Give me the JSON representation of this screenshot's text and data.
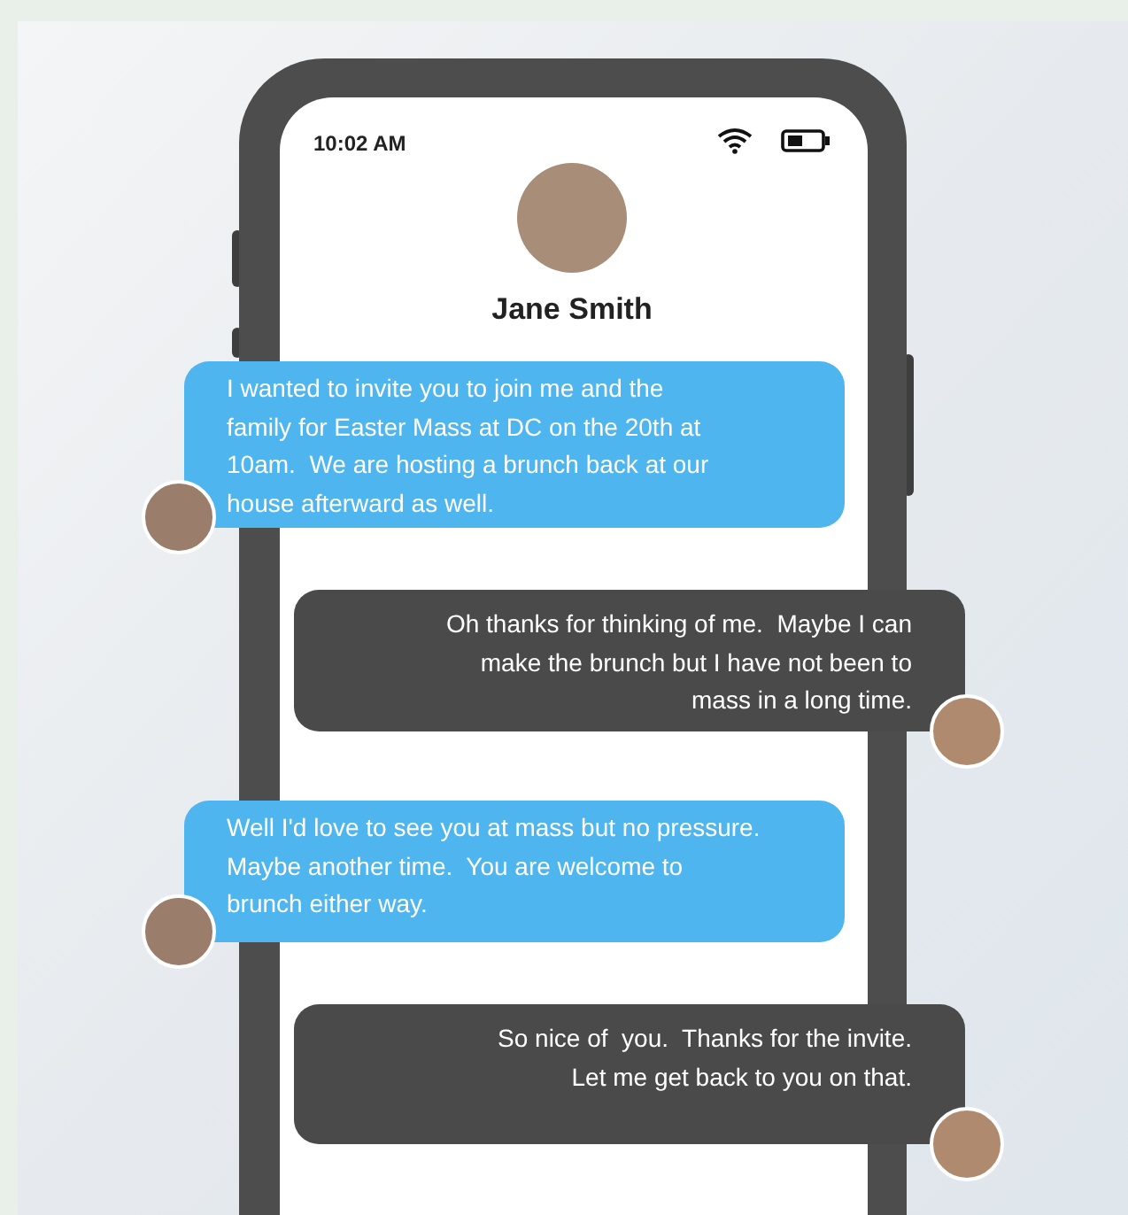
{
  "status_bar": {
    "time": "10:02 AM"
  },
  "contact": {
    "name": "Jane Smith"
  },
  "messages": [
    {
      "kind": "received",
      "lines": [
        "I wanted to invite you to join me and the",
        "family for Easter Mass at DC on the 20th at",
        "10am.  We are hosting a brunch back at our",
        "house afterward as well."
      ]
    },
    {
      "kind": "sent",
      "lines": [
        "Oh thanks for thinking of me.  Maybe I can",
        "make the brunch but I have not been to",
        "mass in a long time."
      ]
    },
    {
      "kind": "received",
      "lines": [
        "Well I'd love to see you at mass but no pressure.",
        "Maybe another time.  You are welcome to",
        "brunch either way."
      ]
    },
    {
      "kind": "sent",
      "lines": [
        "So nice of  you.  Thanks for the invite.",
        "Let me get back to you on that."
      ]
    }
  ]
}
